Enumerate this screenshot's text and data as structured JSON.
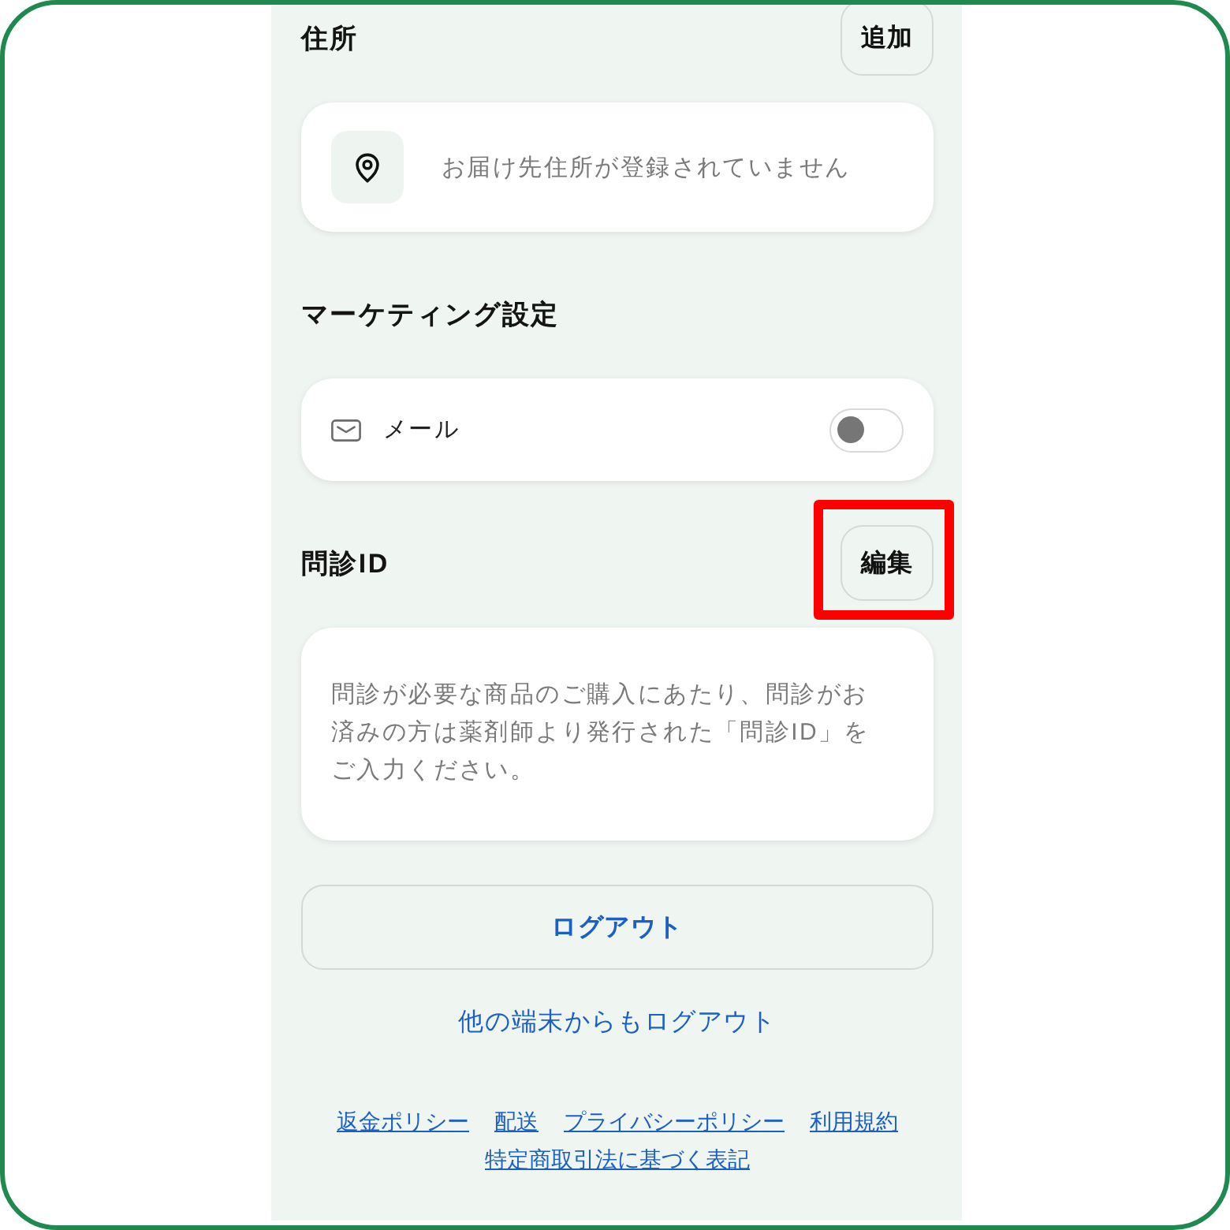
{
  "sections": [
    {
      "kind": "address",
      "title": "住所",
      "button": {
        "label": "追加",
        "highlighted": false
      },
      "empty_message": "お届け先住所が登録されていません"
    },
    {
      "kind": "toggles",
      "title": "マーケティング設定",
      "toggles": [
        {
          "label": "メール",
          "on": false
        }
      ]
    },
    {
      "kind": "notice",
      "title": "問診ID",
      "button": {
        "label": "編集",
        "highlighted": true
      },
      "text": "問診が必要な商品のご購入にあたり、問診がお済みの方は薬剤師より発行された「問診ID」をご入力ください。"
    }
  ],
  "logout_button": "ログアウト",
  "logout_other_devices": "他の端末からもログアウト",
  "footer_links": [
    "返金ポリシー",
    "配送",
    "プライバシーポリシー",
    "利用規約",
    "特定商取引法に基づく表記"
  ]
}
